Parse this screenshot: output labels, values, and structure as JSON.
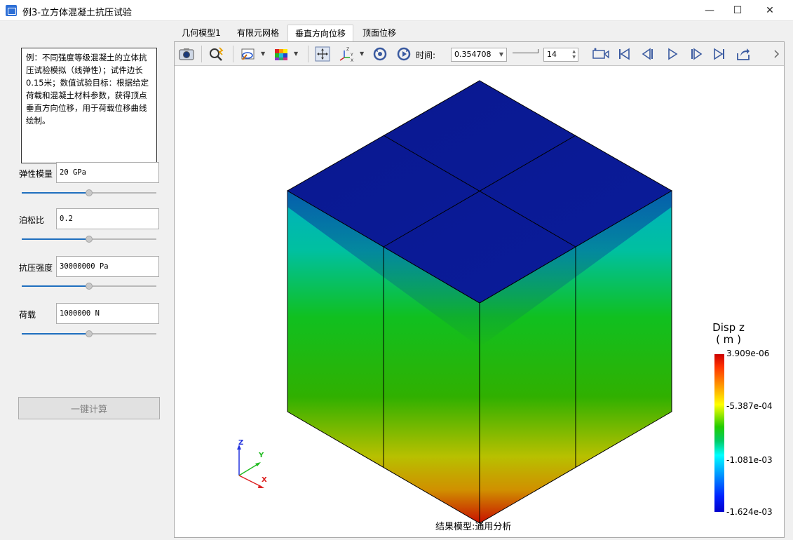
{
  "window": {
    "title": "例3-立方体混凝土抗压试验",
    "minimize": "—",
    "maximize": "☐",
    "close": "✕"
  },
  "left": {
    "description": "例：不同强度等级混凝土的立体抗压试验模拟（线弹性）；试件边长0.15米；数值试验目标：根据给定荷载和混凝土材料参数，获得顶点垂直方向位移，用于荷载位移曲线绘制。",
    "params": [
      {
        "label": "弹性模量",
        "value": "20 GPa",
        "slider": 0.5
      },
      {
        "label": "泊松比",
        "value": "0.2",
        "slider": 0.5
      },
      {
        "label": "抗压强度",
        "value": "30000000 Pa",
        "slider": 0.5
      },
      {
        "label": "荷载",
        "value": "1000000 N",
        "slider": 0.5
      }
    ],
    "calc_button": "一键计算"
  },
  "tabs": [
    {
      "label": "几何模型1",
      "active": false
    },
    {
      "label": "有限元网格",
      "active": false
    },
    {
      "label": "垂直方向位移",
      "active": true
    },
    {
      "label": "顶面位移",
      "active": false
    }
  ],
  "toolbar": {
    "time_label": "时间:",
    "time_value": "0.354708",
    "step_value": "14"
  },
  "viewport": {
    "legend_title": "Disp z",
    "legend_unit": "( m )",
    "legend_values": [
      "3.909e-06",
      "-5.387e-04",
      "-1.081e-03",
      "-1.624e-03"
    ],
    "axis_x": "X",
    "axis_y": "Y",
    "axis_z": "Z",
    "caption": "结果模型:通用分析"
  }
}
